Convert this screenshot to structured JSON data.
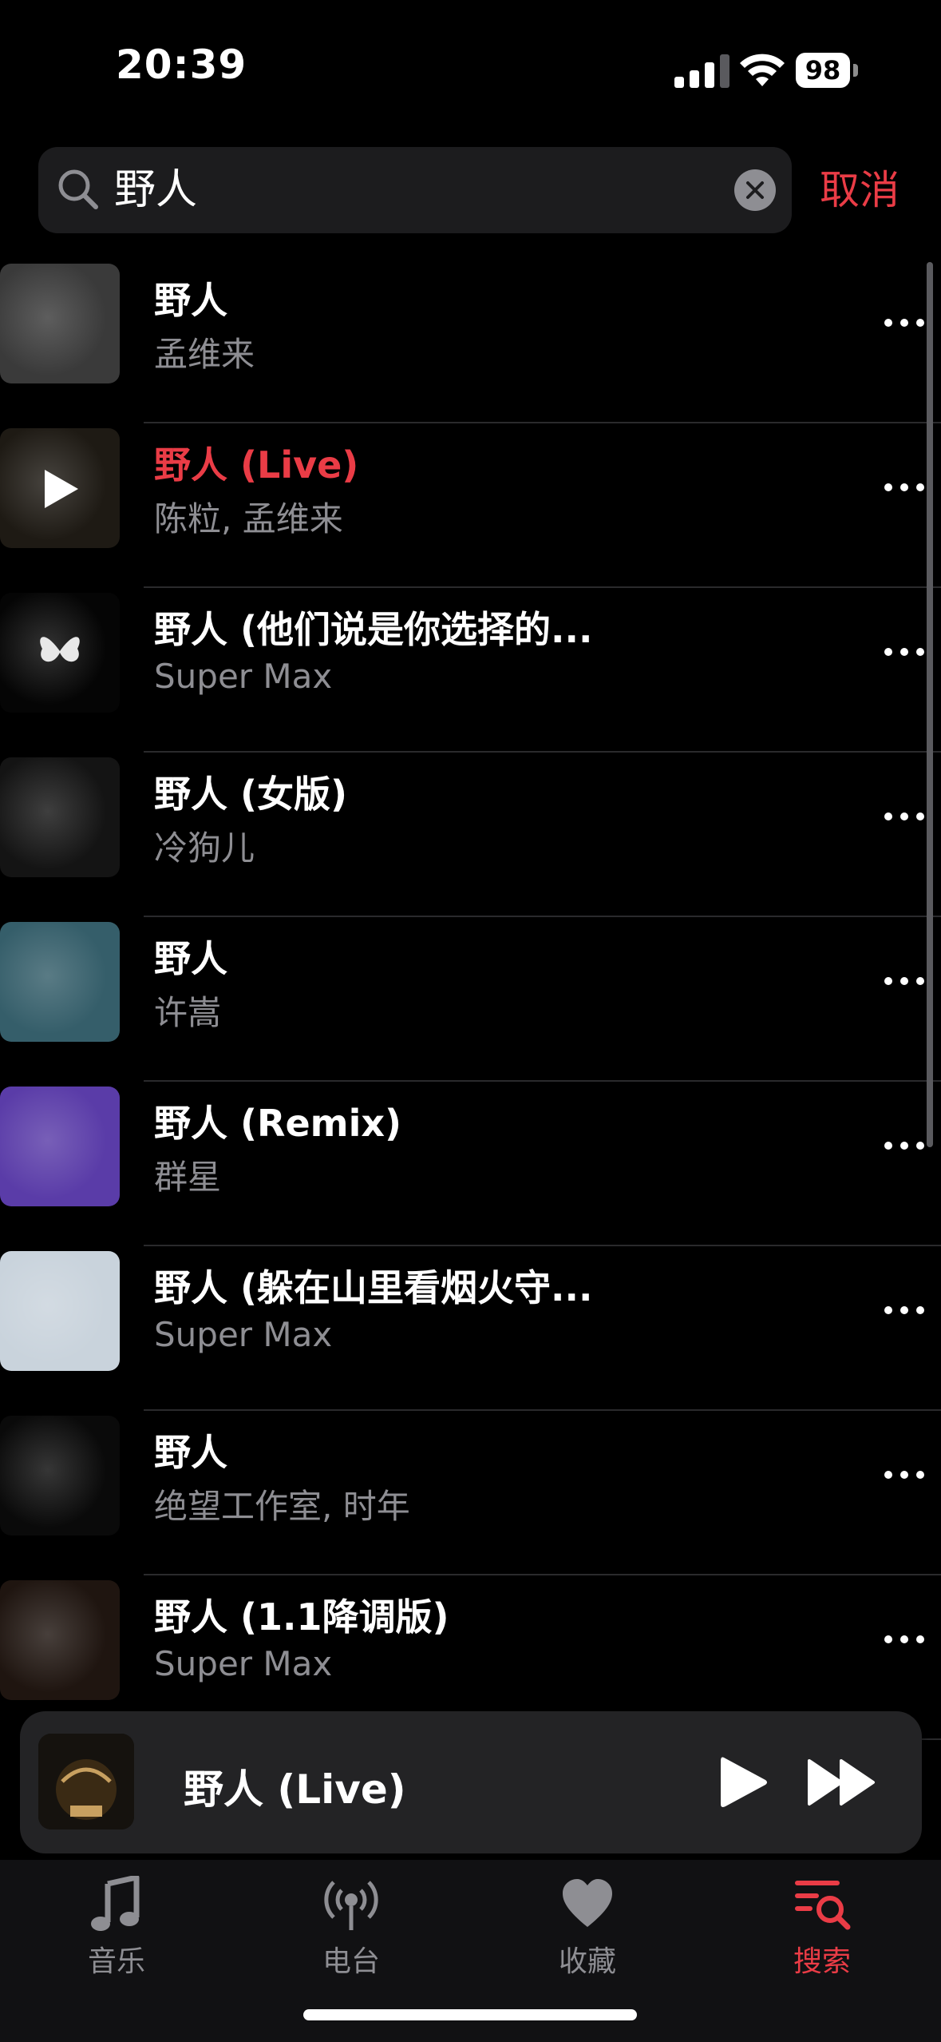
{
  "status": {
    "time": "20:39",
    "battery": "98"
  },
  "search": {
    "query": "野人",
    "cancel_label": "取消"
  },
  "results": [
    {
      "title": "野人",
      "artist": "孟维来",
      "active": false,
      "art_color": "#3a3a3a"
    },
    {
      "title": "野人 (Live)",
      "artist": "陈粒, 孟维来",
      "active": true,
      "art_color": "#1e1a14"
    },
    {
      "title": "野人 (他们说是你选择的...",
      "artist": "Super Max",
      "active": false,
      "art_color": "#050505"
    },
    {
      "title": "野人 (女版)",
      "artist": "冷狗儿",
      "active": false,
      "art_color": "#141414"
    },
    {
      "title": "野人",
      "artist": "许嵩",
      "active": false,
      "art_color": "#355e6a"
    },
    {
      "title": "野人 (Remix)",
      "artist": "群星",
      "active": false,
      "art_color": "#5a3ca8"
    },
    {
      "title": "野人 (躲在山里看烟火守...",
      "artist": "Super Max",
      "active": false,
      "art_color": "#c9d3dc"
    },
    {
      "title": "野人",
      "artist": "绝望工作室, 时年",
      "active": false,
      "art_color": "#0a0a0a"
    },
    {
      "title": "野人 (1.1降调版)",
      "artist": "Super Max",
      "active": false,
      "art_color": "#1f1510"
    }
  ],
  "now_playing": {
    "title": "野人 (Live)"
  },
  "tabs": [
    {
      "label": "音乐",
      "icon": "music-note-icon",
      "active": false
    },
    {
      "label": "电台",
      "icon": "radio-icon",
      "active": false
    },
    {
      "label": "收藏",
      "icon": "heart-icon",
      "active": false
    },
    {
      "label": "搜索",
      "icon": "search-list-icon",
      "active": true
    }
  ],
  "colors": {
    "accent": "#ea3c46",
    "secondary_text": "#8e8e93",
    "background": "#000000"
  }
}
